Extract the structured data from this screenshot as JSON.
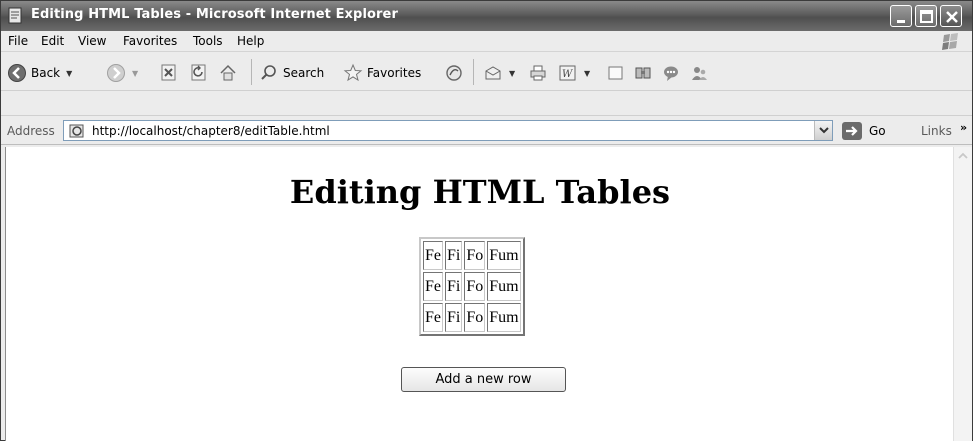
{
  "window": {
    "title": "Editing HTML Tables - Microsoft Internet Explorer"
  },
  "menu": {
    "items": [
      "File",
      "Edit",
      "View",
      "Favorites",
      "Tools",
      "Help"
    ]
  },
  "toolbar": {
    "back_label": "Back",
    "search_label": "Search",
    "favorites_label": "Favorites"
  },
  "address": {
    "label": "Address",
    "url": "http://localhost/chapter8/editTable.html",
    "go_label": "Go",
    "links_label": "Links"
  },
  "page": {
    "heading": "Editing HTML Tables",
    "table": {
      "rows": [
        [
          "Fe",
          "Fi",
          "Fo",
          "Fum"
        ],
        [
          "Fe",
          "Fi",
          "Fo",
          "Fum"
        ],
        [
          "Fe",
          "Fi",
          "Fo",
          "Fum"
        ]
      ]
    },
    "add_row_button": "Add a new row"
  }
}
